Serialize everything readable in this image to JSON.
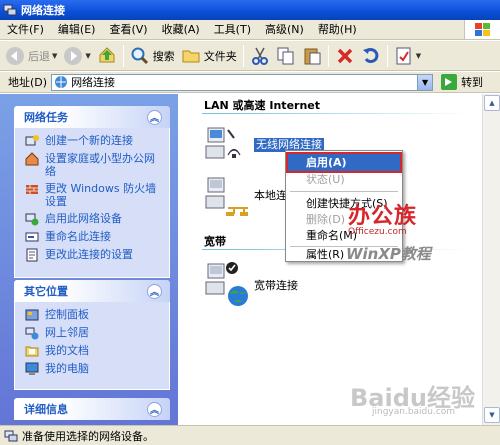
{
  "window": {
    "title": "网络连接"
  },
  "menu": [
    "文件(F)",
    "编辑(E)",
    "查看(V)",
    "收藏(A)",
    "工具(T)",
    "高级(N)",
    "帮助(H)"
  ],
  "toolbar": {
    "back": "后退",
    "search": "搜索",
    "folders": "文件夹"
  },
  "address": {
    "label": "地址(D)",
    "value": "网络连接",
    "go": "转到"
  },
  "tasks": {
    "header": "网络任务",
    "items": [
      "创建一个新的连接",
      "设置家庭或小型办公网络",
      "更改 Windows 防火墙设置",
      "启用此网络设备",
      "重命名此连接",
      "更改此连接的设置"
    ]
  },
  "places": {
    "header": "其它位置",
    "items": [
      "控制面板",
      "网上邻居",
      "我的文档",
      "我的电脑"
    ]
  },
  "details": {
    "header": "详细信息"
  },
  "groups": {
    "lan_header": "LAN 或高速 Internet",
    "wireless_label": "无线网络连接",
    "local_label": "本地连",
    "broadband_header": "宽带",
    "broadband_label": "宽带连接"
  },
  "context_menu": {
    "items": [
      "启用(A)",
      "状态(U)",
      "创建快捷方式(S)",
      "删除(D)",
      "重命名(M)",
      "属性(R)"
    ]
  },
  "status": {
    "text": "准备使用选择的网络设备。"
  },
  "watermarks": {
    "brand": "办公族",
    "brand_url": "Officezu.com",
    "xp": "WinXP教程",
    "baidu": "Baidu经验",
    "baidu_url": "jingyan.baidu.com"
  },
  "colors": {
    "selection": "#316ac5",
    "highlight_border": "#d8272b",
    "link": "#215dc6"
  }
}
